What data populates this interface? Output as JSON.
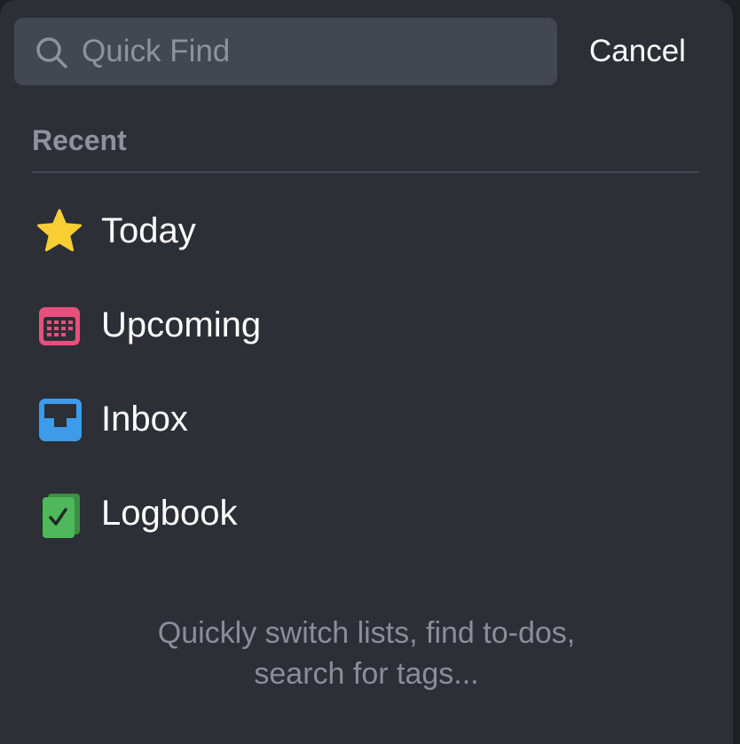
{
  "search": {
    "placeholder": "Quick Find",
    "value": "",
    "cancel_label": "Cancel"
  },
  "recent": {
    "header": "Recent",
    "items": [
      {
        "label": "Today",
        "icon": "star-icon",
        "color": "#f7cf33"
      },
      {
        "label": "Upcoming",
        "icon": "calendar-icon",
        "color": "#e84f7c"
      },
      {
        "label": "Inbox",
        "icon": "inbox-icon",
        "color": "#3e9bea"
      },
      {
        "label": "Logbook",
        "icon": "logbook-icon",
        "color": "#4fb85a"
      }
    ]
  },
  "hint": {
    "line1": "Quickly switch lists, find to-dos,",
    "line2": "search for tags..."
  },
  "colors": {
    "background": "#2c2f36",
    "search_field": "#434751",
    "secondary_text": "#8e929b"
  }
}
